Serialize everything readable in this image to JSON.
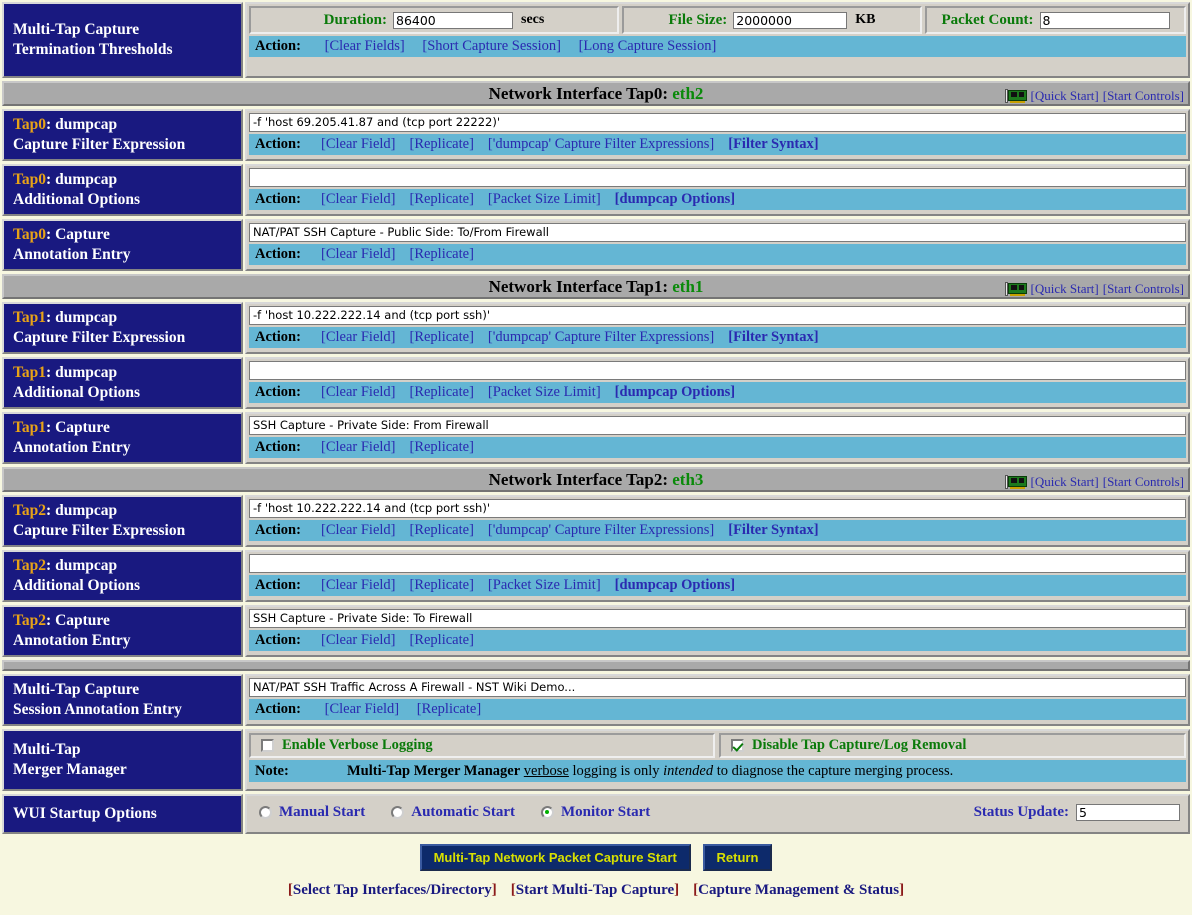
{
  "thresholds": {
    "label_line1": "Multi-Tap Capture",
    "label_line2": "Termination Thresholds",
    "duration_label": "Duration:",
    "duration_value": "86400",
    "duration_unit": "secs",
    "filesize_label": "File Size:",
    "filesize_value": "2000000",
    "filesize_unit": "KB",
    "packetcount_label": "Packet Count:",
    "packetcount_value": "8",
    "action_label": "Action:",
    "actions": [
      "[Clear Fields]",
      "[Short Capture Session]",
      "[Long Capture Session]"
    ]
  },
  "common": {
    "action_label": "Action:",
    "quick_start": "[Quick Start]",
    "start_controls": "[Start Controls]",
    "nic_icon": "network-card-icon",
    "filter_actions": [
      "[Clear Field]",
      "[Replicate]",
      "['dumpcap' Capture Filter Expressions]",
      "[Filter Syntax]"
    ],
    "options_actions": [
      "[Clear Field]",
      "[Replicate]",
      "[Packet Size Limit]",
      "[dumpcap Options]"
    ],
    "annotation_actions": [
      "[Clear Field]",
      "[Replicate]"
    ]
  },
  "taps": [
    {
      "banner_prefix": "Network Interface Tap0: ",
      "banner_iface": "eth2",
      "filter_label_tap": "Tap0",
      "filter_label_rest": ": dumpcap",
      "filter_label_line2": "Capture Filter Expression",
      "filter_value": "-f 'host 69.205.41.87 and (tcp port 22222)'",
      "options_label_tap": "Tap0",
      "options_label_rest": ": dumpcap",
      "options_label_line2": "Additional Options",
      "options_value": "",
      "annotation_label_tap": "Tap0",
      "annotation_label_rest": ": Capture",
      "annotation_label_line2": "Annotation Entry",
      "annotation_value": "NAT/PAT SSH Capture - Public Side: To/From Firewall"
    },
    {
      "banner_prefix": "Network Interface Tap1: ",
      "banner_iface": "eth1",
      "filter_label_tap": "Tap1",
      "filter_label_rest": ": dumpcap",
      "filter_label_line2": "Capture Filter Expression",
      "filter_value": "-f 'host 10.222.222.14 and (tcp port ssh)'",
      "options_label_tap": "Tap1",
      "options_label_rest": ": dumpcap",
      "options_label_line2": "Additional Options",
      "options_value": "",
      "annotation_label_tap": "Tap1",
      "annotation_label_rest": ": Capture",
      "annotation_label_line2": "Annotation Entry",
      "annotation_value": "SSH Capture - Private Side: From Firewall"
    },
    {
      "banner_prefix": "Network Interface Tap2: ",
      "banner_iface": "eth3",
      "filter_label_tap": "Tap2",
      "filter_label_rest": ": dumpcap",
      "filter_label_line2": "Capture Filter Expression",
      "filter_value": "-f 'host 10.222.222.14 and (tcp port ssh)'",
      "options_label_tap": "Tap2",
      "options_label_rest": ": dumpcap",
      "options_label_line2": "Additional Options",
      "options_value": "",
      "annotation_label_tap": "Tap2",
      "annotation_label_rest": ": Capture",
      "annotation_label_line2": "Annotation Entry",
      "annotation_value": "SSH Capture - Private Side: To Firewall"
    }
  ],
  "session_annotation": {
    "label_line1": "Multi-Tap Capture",
    "label_line2": "Session Annotation Entry",
    "value": "NAT/PAT SSH Traffic Across A  Firewall - NST Wiki Demo...",
    "action_label": "Action:",
    "actions": [
      "[Clear Field]",
      "[Replicate]"
    ]
  },
  "merger": {
    "label_line1": "Multi-Tap",
    "label_line2": "Merger Manager",
    "verbose_label": "Enable Verbose Logging",
    "verbose_checked": false,
    "disable_removal_label": "Disable Tap Capture/Log Removal",
    "disable_removal_checked": true,
    "note_key": "Note:",
    "note_bold": "Multi-Tap Merger Manager",
    "note_underline": "verbose",
    "note_mid": " logging is only ",
    "note_italic": "intended",
    "note_end": " to diagnose the capture merging process."
  },
  "wui": {
    "label": "WUI Startup Options",
    "options": [
      {
        "label": "Manual Start",
        "selected": false
      },
      {
        "label": "Automatic Start",
        "selected": false
      },
      {
        "label": "Monitor Start",
        "selected": true
      }
    ],
    "status_update_label": "Status Update:",
    "status_update_value": "5"
  },
  "footer": {
    "primary_button": "Multi-Tap Network Packet Capture Start",
    "return_button": "Return",
    "links": [
      "[Select Tap Interfaces/Directory]",
      "[Start Multi-Tap Capture]",
      "[Capture Management & Status]"
    ]
  },
  "colors": {
    "page_bg": "#f7f7e0",
    "label_bg": "#191980",
    "tap_accent": "#e8a317",
    "action_bar": "#64b6d4",
    "banner_bg": "#a9a9a9",
    "field_label_green": "#0a7a0a",
    "link_blue": "#2a2ab0",
    "iface_green": "#0a8a0a",
    "button_bg": "#0d2a6b",
    "button_fg": "#d8e000"
  }
}
